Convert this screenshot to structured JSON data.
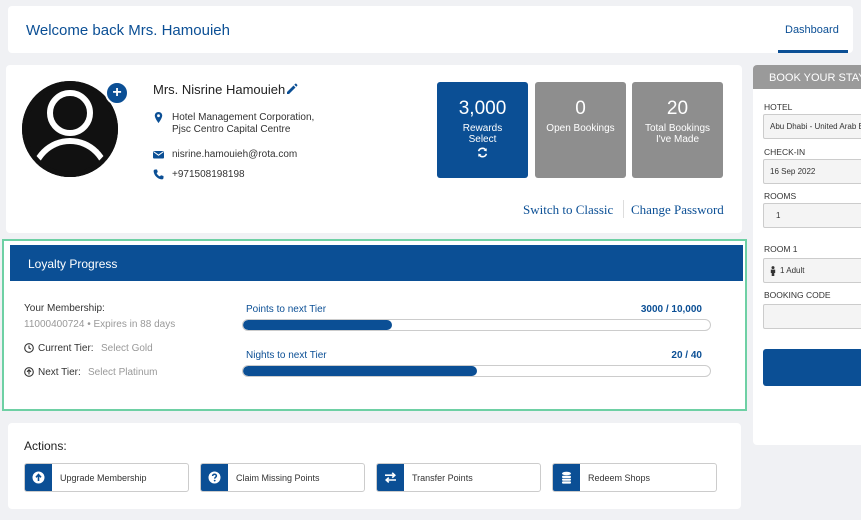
{
  "header": {
    "welcome": "Welcome back Mrs. Hamouieh",
    "dashboard_tab": "Dashboard"
  },
  "profile": {
    "name": "Mrs. Nisrine Hamouieh",
    "company_line1": "Hotel Management Corporation,",
    "company_line2": "Pjsc Centro Capital Centre",
    "email": "nisrine.hamouieh@rota.com",
    "phone": "+971508198198"
  },
  "tiles": [
    {
      "value": "3,000",
      "label1": "Rewards",
      "label2": "Select"
    },
    {
      "value": "0",
      "label1": "Open Bookings",
      "label2": ""
    },
    {
      "value": "20",
      "label1": "Total Bookings",
      "label2": "I've Made"
    }
  ],
  "links": {
    "switch": "Switch to Classic",
    "password": "Change Password"
  },
  "loyalty": {
    "title": "Loyalty Progress",
    "membership_label": "Your Membership:",
    "membership_detail": "11000400724 • Expires in 88 days",
    "current_tier_label": "Current Tier:",
    "current_tier_value": "Select Gold",
    "next_tier_label": "Next Tier:",
    "next_tier_value": "Select Platinum",
    "points_label": "Points to next Tier",
    "points_value": "3000 / 10,000",
    "points_progress": 0.32,
    "nights_label": "Nights to next Tier",
    "nights_value": "20 / 40",
    "nights_progress": 0.5
  },
  "actions": {
    "title": "Actions:",
    "buttons": [
      {
        "label": "Upgrade Membership",
        "icon": "upgrade-arrow-icon"
      },
      {
        "label": "Claim Missing Points",
        "icon": "question-icon"
      },
      {
        "label": "Transfer Points",
        "icon": "transfer-arrows-icon"
      },
      {
        "label": "Redeem Shops",
        "icon": "coins-icon"
      }
    ]
  },
  "booking": {
    "title": "BOOK YOUR STAY",
    "hotel_label": "HOTEL",
    "hotel_value": "Abu Dhabi - United Arab E",
    "checkin_label": "CHECK-IN",
    "checkin_value": "16 Sep 2022",
    "rooms_label": "ROOMS",
    "rooms_value": "1",
    "room1_label": "ROOM 1",
    "room1_value": "1 Adult",
    "code_label": "BOOKING CODE",
    "code_value": ""
  },
  "colors": {
    "brand": "#0b4f95",
    "tile_gray": "#8e8e8e",
    "highlight": "#6ed0a4"
  }
}
